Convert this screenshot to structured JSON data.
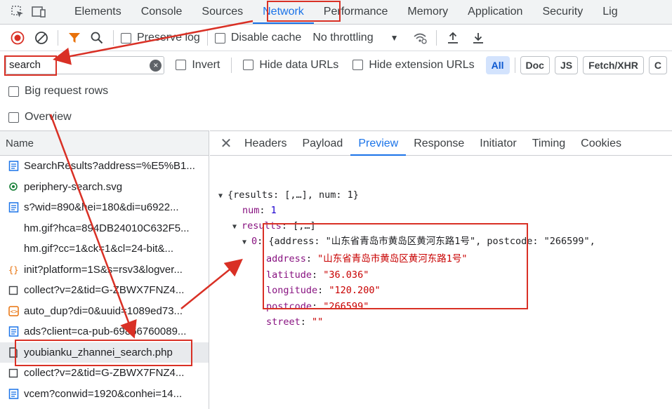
{
  "top_tabs": [
    "Elements",
    "Console",
    "Sources",
    "Network",
    "Performance",
    "Memory",
    "Application",
    "Security",
    "Lig"
  ],
  "active_top_tab": "Network",
  "toolbar": {
    "preserve_log": "Preserve log",
    "disable_cache": "Disable cache",
    "throttling": "No throttling"
  },
  "filter": {
    "value": "search",
    "invert": "Invert",
    "hide_data_urls": "Hide data URLs",
    "hide_extension_urls": "Hide extension URLs",
    "type_chips": [
      "All",
      "Doc",
      "JS",
      "Fetch/XHR",
      "C"
    ]
  },
  "options": {
    "big_request_rows": "Big request rows",
    "overview": "Overview"
  },
  "list": {
    "column_name": "Name",
    "requests": [
      {
        "name": "SearchResults?address=%E5%B1...",
        "icon": "doc-icon"
      },
      {
        "name": "periphery-search.svg",
        "icon": "image-icon"
      },
      {
        "name": "s?wid=890&hei=180&di=u6922...",
        "icon": "doc-icon"
      },
      {
        "name": "hm.gif?hca=894DB24010C632F5...",
        "icon": "none"
      },
      {
        "name": "hm.gif?cc=1&ck=1&cl=24-bit&...",
        "icon": "none"
      },
      {
        "name": "init?platform=1S&s=rsv3&logver...",
        "icon": "json-icon"
      },
      {
        "name": "collect?v=2&tid=G-ZBWX7FNZ4...",
        "icon": "other-icon"
      },
      {
        "name": "auto_dup?di=0&uuid=1089ed73...",
        "icon": "script-icon"
      },
      {
        "name": "ads?client=ca-pub-69866760089...",
        "icon": "doc-icon"
      },
      {
        "name": "youbianku_zhannei_search.php",
        "icon": "file-icon"
      },
      {
        "name": "collect?v=2&tid=G-ZBWX7FNZ4...",
        "icon": "other-icon"
      },
      {
        "name": "vcem?conwid=1920&conhei=14...",
        "icon": "doc-icon"
      }
    ],
    "selected_index": 9
  },
  "detail_tabs": [
    "Headers",
    "Payload",
    "Preview",
    "Response",
    "Initiator",
    "Timing",
    "Cookies"
  ],
  "active_detail_tab": "Preview",
  "preview": {
    "root": "{results: [,…], num: 1}",
    "num_key": "num",
    "num_val": "1",
    "results_key": "results",
    "results_val": "[,…]",
    "item0_prefix": "0",
    "item0_summary": "{address: \"山东省青岛市黄岛区黄河东路1号\", postcode: \"266599\",",
    "fields": [
      {
        "key": "address",
        "value": "\"山东省青岛市黄岛区黄河东路1号\""
      },
      {
        "key": "latitude",
        "value": "\"36.036\""
      },
      {
        "key": "longitude",
        "value": "\"120.200\""
      },
      {
        "key": "postcode",
        "value": "\"266599\""
      },
      {
        "key": "street",
        "value": "\"\""
      }
    ]
  },
  "colors": {
    "accent": "#1a73e8",
    "annotation": "#d93025",
    "record_red": "#d93025",
    "filter_orange": "#e8710a"
  }
}
